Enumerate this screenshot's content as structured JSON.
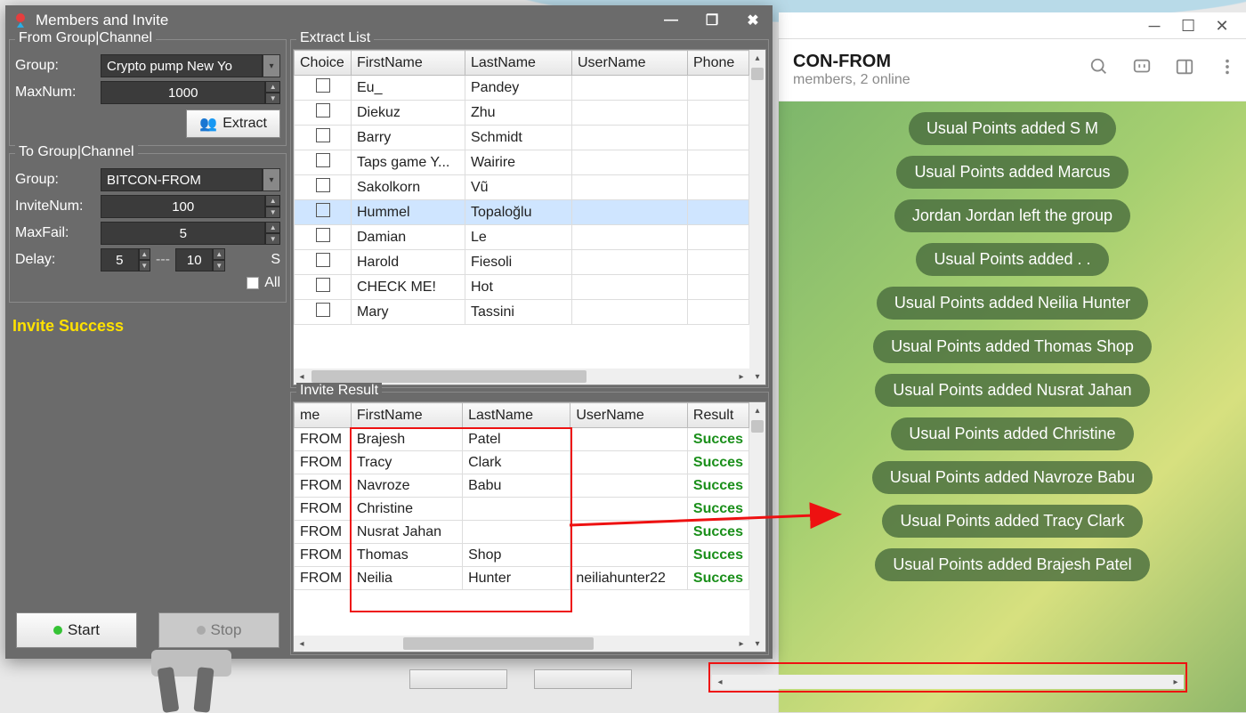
{
  "app": {
    "title": "Members and Invite",
    "from": {
      "groupbox": "From Group|Channel",
      "group_label": "Group:",
      "group_value": "Crypto pump New Yo",
      "maxnum_label": "MaxNum:",
      "maxnum_value": "1000",
      "extract_btn": "Extract"
    },
    "to": {
      "groupbox": "To Group|Channel",
      "group_label": "Group:",
      "group_value": "BITCON-FROM",
      "invitenum_label": "InviteNum:",
      "invitenum_value": "100",
      "maxfail_label": "MaxFail:",
      "maxfail_value": "5",
      "delay_label": "Delay:",
      "delay_from": "5",
      "delay_sep": "---",
      "delay_to": "10",
      "delay_unit": "S",
      "all_label": "All"
    },
    "status": "Invite Success",
    "start_btn": "Start",
    "stop_btn": "Stop"
  },
  "extractList": {
    "title": "Extract List",
    "headers": [
      "Choice",
      "FirstName",
      "LastName",
      "UserName",
      "Phone"
    ],
    "rows": [
      {
        "first": "Eu_",
        "last": "Pandey",
        "user": "",
        "phone": "",
        "sel": false
      },
      {
        "first": "Diekuz",
        "last": "Zhu",
        "user": "",
        "phone": "",
        "sel": false
      },
      {
        "first": "Barry",
        "last": "Schmidt",
        "user": "",
        "phone": "",
        "sel": false
      },
      {
        "first": "Taps game Y...",
        "last": "Wairire",
        "user": "",
        "phone": "",
        "sel": false
      },
      {
        "first": "Sakolkorn",
        "last": "Vũ",
        "user": "",
        "phone": "",
        "sel": false
      },
      {
        "first": "Hummel",
        "last": "Topaloğlu",
        "user": "",
        "phone": "",
        "sel": true
      },
      {
        "first": "Damian",
        "last": "Le",
        "user": "",
        "phone": "",
        "sel": false
      },
      {
        "first": "Harold",
        "last": "Fiesoli",
        "user": "",
        "phone": "",
        "sel": false
      },
      {
        "first": "CHECK ME!",
        "last": "Hot",
        "user": "",
        "phone": "",
        "sel": false
      },
      {
        "first": "Mary",
        "last": "Tassini",
        "user": "",
        "phone": "",
        "sel": false
      }
    ]
  },
  "inviteResult": {
    "title": "Invite Result",
    "headers": [
      "me",
      "FirstName",
      "LastName",
      "UserName",
      "Result"
    ],
    "rows": [
      {
        "me": "FROM",
        "first": "Brajesh",
        "last": "Patel",
        "user": "",
        "result": "Succes"
      },
      {
        "me": "FROM",
        "first": "Tracy",
        "last": "Clark",
        "user": "",
        "result": "Succes"
      },
      {
        "me": "FROM",
        "first": "Navroze",
        "last": "Babu",
        "user": "",
        "result": "Succes"
      },
      {
        "me": "FROM",
        "first": "Christine",
        "last": "",
        "user": "",
        "result": "Succes"
      },
      {
        "me": "FROM",
        "first": "Nusrat Jahan",
        "last": "",
        "user": "",
        "result": "Succes"
      },
      {
        "me": "FROM",
        "first": "Thomas",
        "last": "Shop",
        "user": "",
        "result": "Succes"
      },
      {
        "me": "FROM",
        "first": "Neilia",
        "last": "Hunter",
        "user": "neiliahunter22",
        "result": "Succes"
      }
    ]
  },
  "telegram": {
    "title": "CON-FROM",
    "subtitle": "members, 2 online",
    "pills": [
      "Usual Points added S M",
      "Usual Points added Marcus",
      "Jordan Jordan left the group",
      "Usual Points added . .",
      "Usual Points added Neilia Hunter",
      "Usual Points added Thomas Shop",
      "Usual Points added Nusrat Jahan",
      "Usual Points added Christine",
      "Usual Points added Navroze Babu",
      "Usual Points added Tracy Clark",
      "Usual Points added Brajesh Patel"
    ]
  }
}
